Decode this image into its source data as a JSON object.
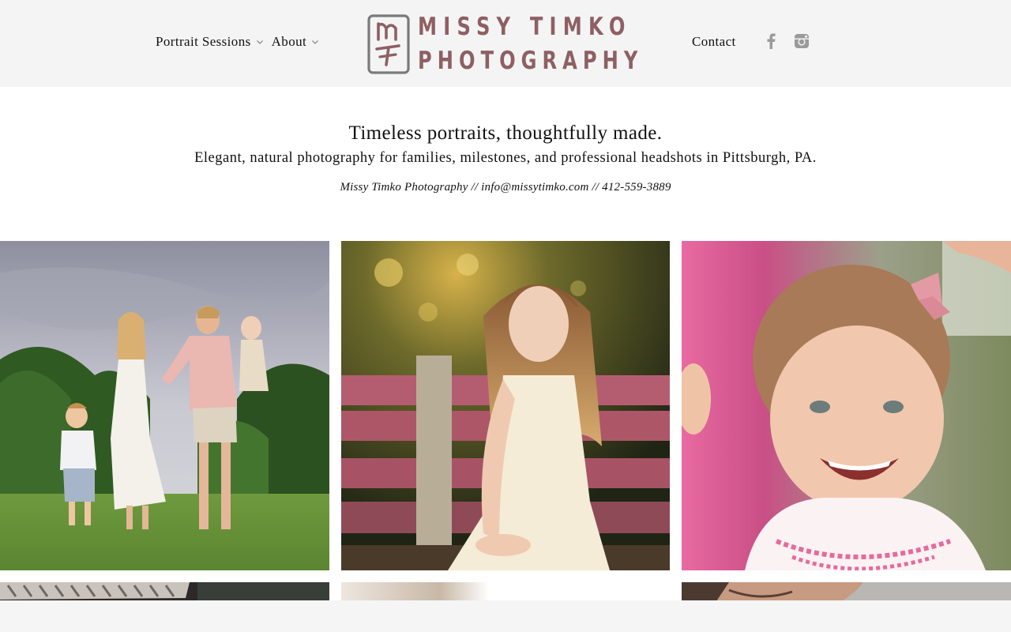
{
  "nav": {
    "portrait_sessions": "Portrait Sessions",
    "about": "About",
    "contact": "Contact"
  },
  "logo": {
    "monogram": "MT",
    "line1": "MISSY TIMKO",
    "line2": "PHOTOGRAPHY",
    "color": "#8e5f63"
  },
  "social": {
    "facebook_icon": "facebook-icon",
    "instagram_icon": "instagram-icon",
    "icon_color": "#9a9a9a"
  },
  "intro": {
    "tagline": "Timeless portraits, thoughtfully made.",
    "subline": "Elegant, natural photography for families, milestones, and professional headshots in Pittsburgh, PA.",
    "contact_line": "Missy Timko Photography // info@missytimko.com // 412-559-3889"
  },
  "gallery": {
    "photos": [
      {
        "subject": "family-walking-in-field"
      },
      {
        "subject": "girl-on-pink-bench"
      },
      {
        "subject": "laughing-toddler"
      },
      {
        "subject": "partial-photo-4"
      },
      {
        "subject": "partial-photo-5"
      },
      {
        "subject": "partial-photo-6"
      }
    ]
  }
}
